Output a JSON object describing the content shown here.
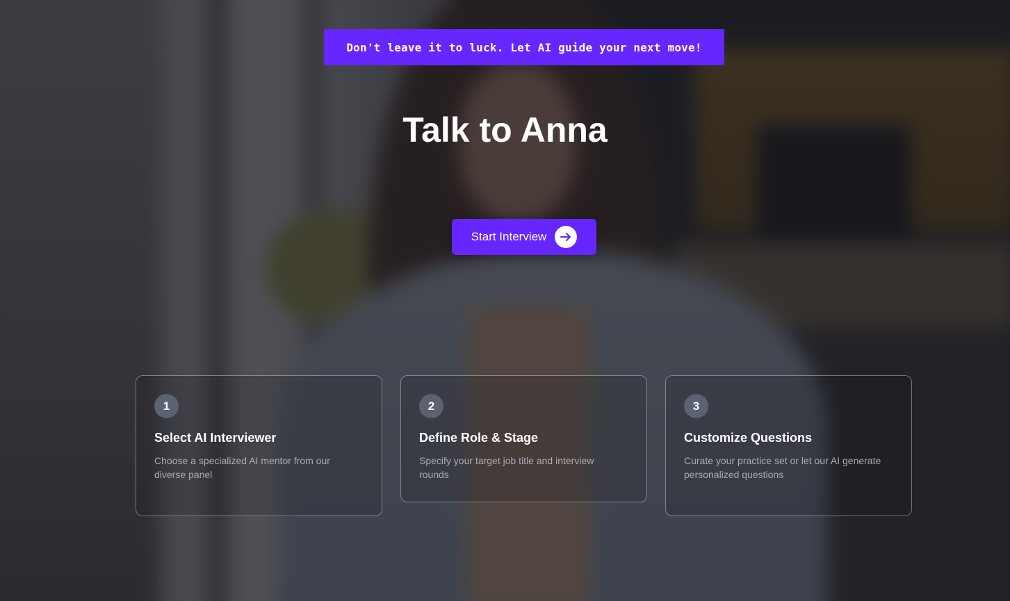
{
  "banner": {
    "tagline": "Don't leave it to luck. Let AI guide your next move!"
  },
  "hero": {
    "title": "Talk to Anna",
    "start_button_label": "Start Interview",
    "start_button_icon": "arrow-right-icon"
  },
  "steps": [
    {
      "number": "1",
      "title": "Select AI Interviewer",
      "description": "Choose a specialized AI mentor from our diverse panel"
    },
    {
      "number": "2",
      "title": "Define Role & Stage",
      "description": "Specify your target job title and interview rounds"
    },
    {
      "number": "3",
      "title": "Customize Questions",
      "description": "Curate your practice set or let our AI generate personalized questions"
    }
  ],
  "colors": {
    "accent": "#6526ff",
    "step_badge": "#5c6272",
    "muted_text": "#a9acb4"
  }
}
